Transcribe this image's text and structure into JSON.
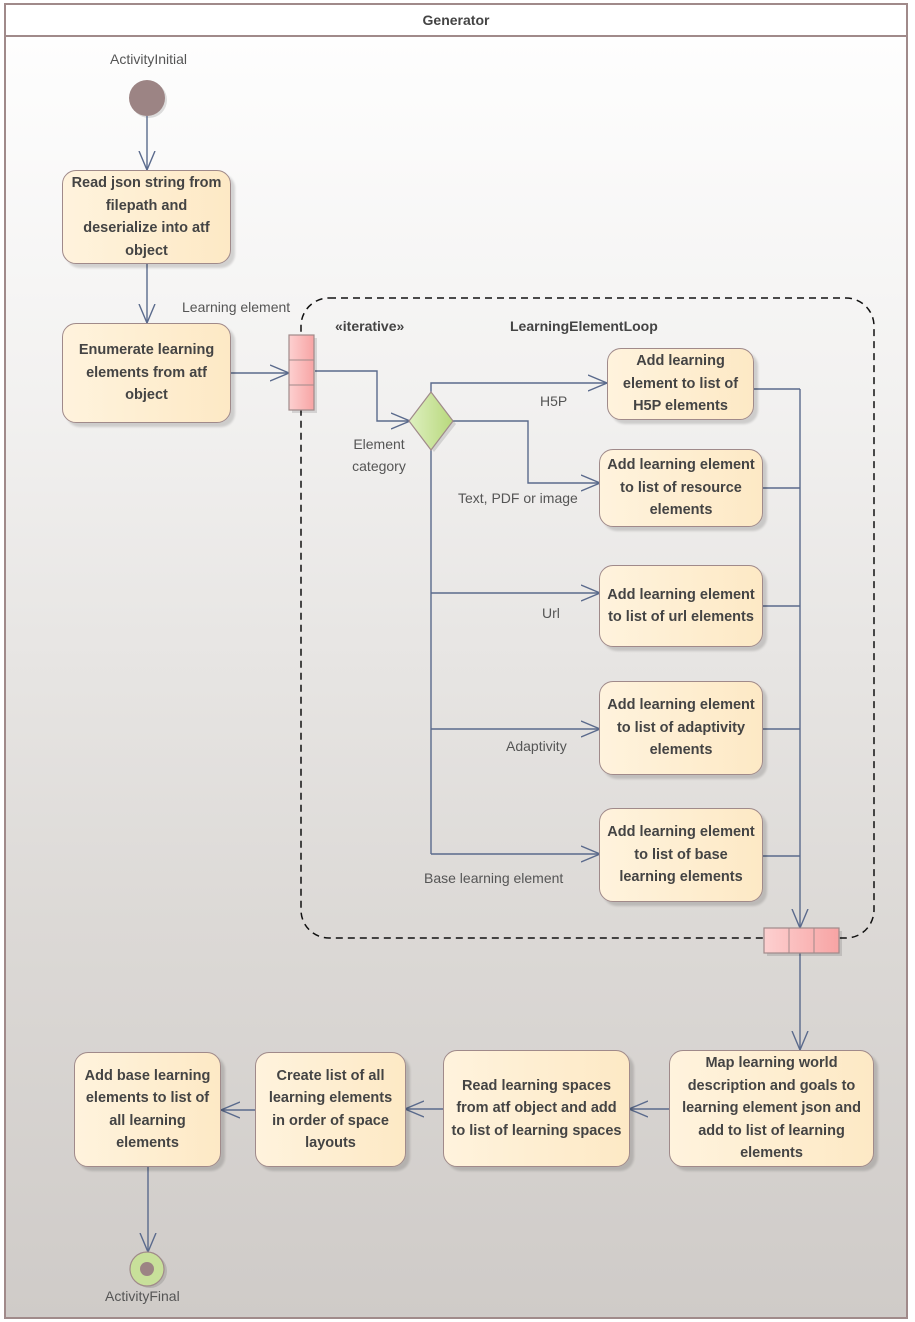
{
  "diagram": {
    "title": "Generator",
    "initial_node": {
      "label": "ActivityInitial"
    },
    "final_node": {
      "label": "ActivityFinal"
    },
    "actions": {
      "read_json": "Read json string from filepath and deserialize into atf object",
      "enumerate": "Enumerate learning elements from  atf object",
      "add_h5p": "Add learning element to list of H5P elements",
      "add_resource": "Add learning element to list of resource elements",
      "add_url": "Add learning element to list of url elements",
      "add_adaptivity": "Add learning element to list of adaptivity elements",
      "add_base": "Add learning element to list of base learning elements",
      "map_world": "Map learning world description and goals to learning element json and add to list of learning elements",
      "read_spaces": "Read learning spaces from atf object and add to list of learning spaces",
      "create_list": "Create list of all learning elements in order of space layouts",
      "add_base_all": "Add base learning elements to list of all learning elements"
    },
    "region": {
      "stereotype": "«iterative»",
      "name": "LearningElementLoop",
      "input_pin_label": "Learning element"
    },
    "decision": {
      "label": "Element category"
    },
    "guards": {
      "h5p": "H5P",
      "resource": "Text, PDF or image",
      "url": "Url",
      "adaptivity": "Adaptivity",
      "base": "Base learning element"
    },
    "colors": {
      "action_fill": "#fde9c5",
      "action_border": "#a08a8a",
      "edge": "#5a6a8c",
      "pin_fill": "#fbbcbc",
      "decision_fill": "#c8e09a",
      "initial_fill": "#9c8484"
    }
  }
}
